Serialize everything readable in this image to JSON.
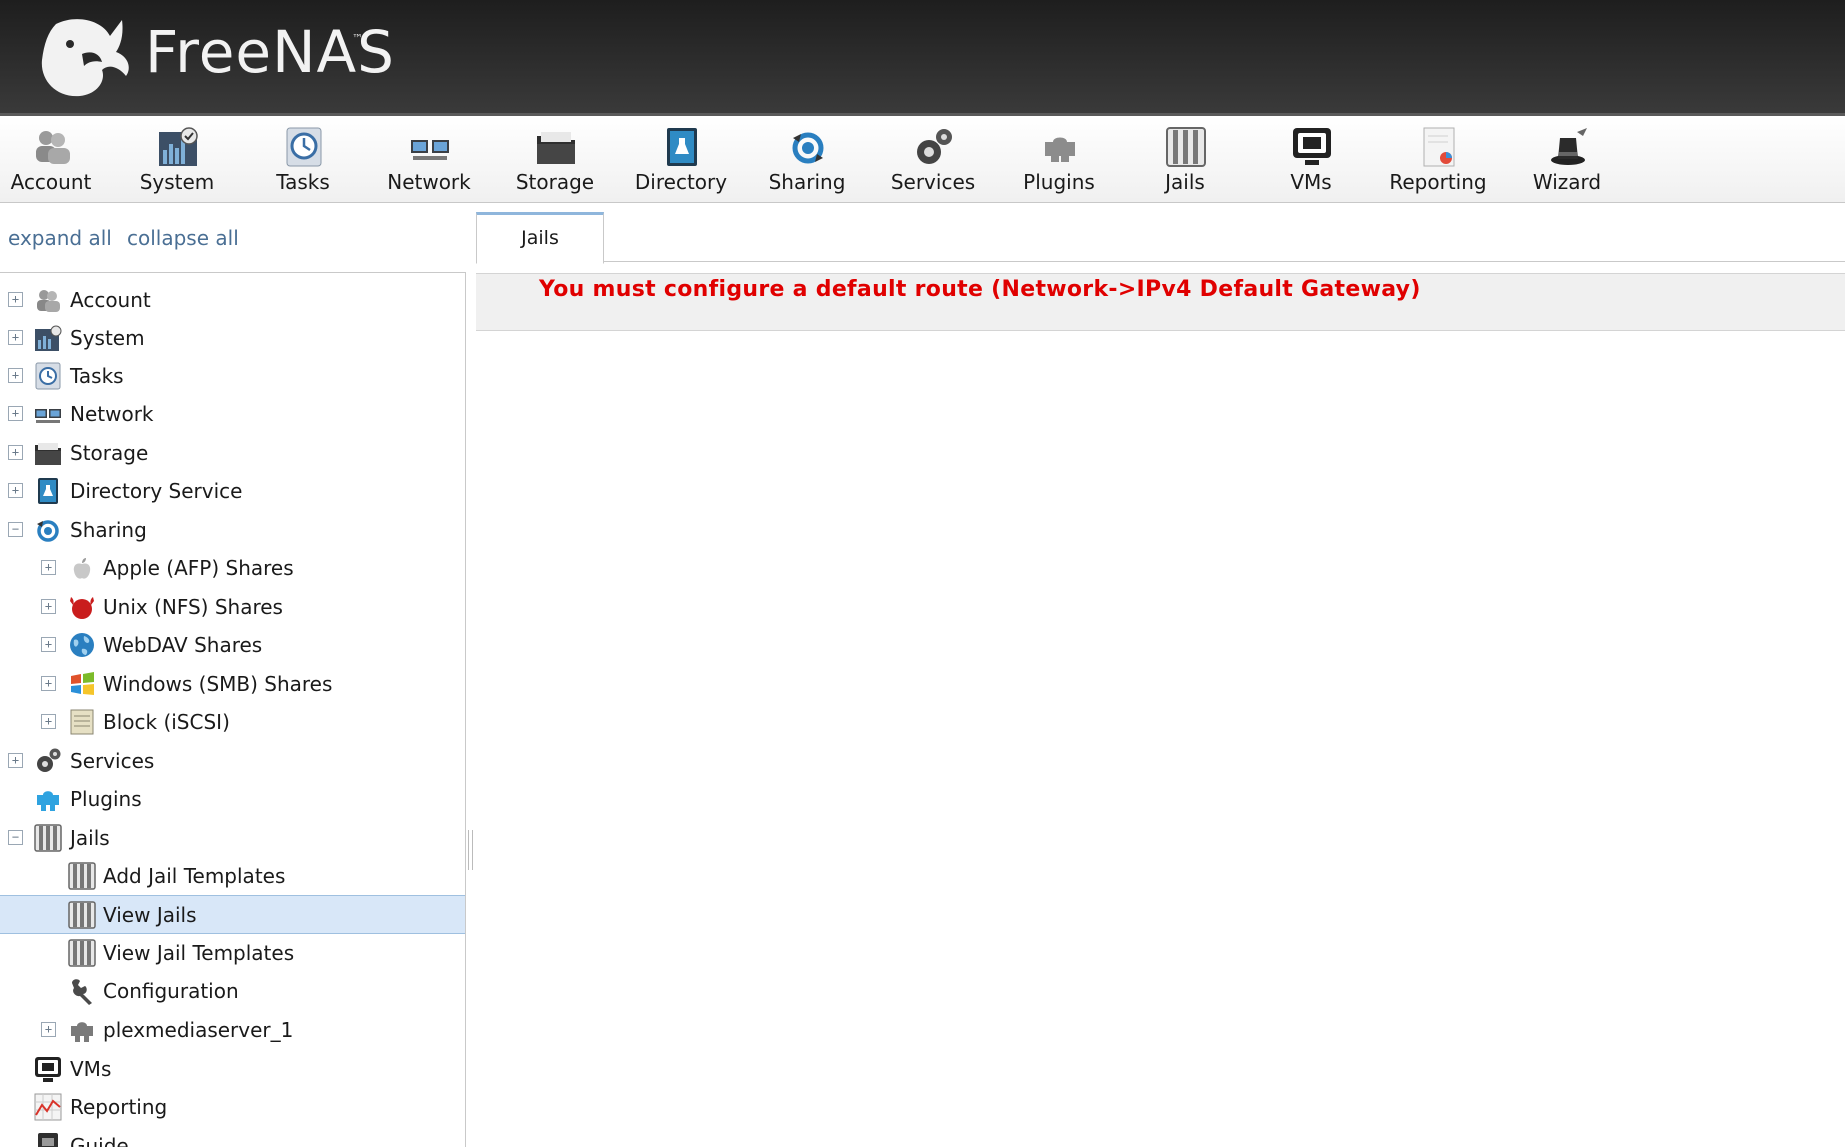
{
  "header": {
    "brand": "FreeNAS",
    "trademark": "™"
  },
  "toolbar": {
    "items": [
      {
        "label": "Account",
        "icon": "account-icon"
      },
      {
        "label": "System",
        "icon": "system-icon"
      },
      {
        "label": "Tasks",
        "icon": "tasks-icon"
      },
      {
        "label": "Network",
        "icon": "network-icon"
      },
      {
        "label": "Storage",
        "icon": "storage-icon"
      },
      {
        "label": "Directory",
        "icon": "directory-icon"
      },
      {
        "label": "Sharing",
        "icon": "sharing-icon"
      },
      {
        "label": "Services",
        "icon": "services-icon"
      },
      {
        "label": "Plugins",
        "icon": "plugins-icon"
      },
      {
        "label": "Jails",
        "icon": "jails-icon"
      },
      {
        "label": "VMs",
        "icon": "vms-icon"
      },
      {
        "label": "Reporting",
        "icon": "reporting-icon"
      },
      {
        "label": "Wizard",
        "icon": "wizard-icon"
      }
    ]
  },
  "sidebar": {
    "expand_all": "expand all",
    "collapse_all": "collapse all",
    "tree": [
      {
        "label": "Account",
        "toggle": "+",
        "icon": "account-icon"
      },
      {
        "label": "System",
        "toggle": "+",
        "icon": "system-icon"
      },
      {
        "label": "Tasks",
        "toggle": "+",
        "icon": "tasks-icon"
      },
      {
        "label": "Network",
        "toggle": "+",
        "icon": "network-icon"
      },
      {
        "label": "Storage",
        "toggle": "+",
        "icon": "storage-icon"
      },
      {
        "label": "Directory Service",
        "toggle": "+",
        "icon": "directory-icon"
      },
      {
        "label": "Sharing",
        "toggle": "−",
        "icon": "sharing-icon"
      },
      {
        "label": "Apple (AFP) Shares",
        "toggle": "+",
        "icon": "apple-icon"
      },
      {
        "label": "Unix (NFS) Shares",
        "toggle": "+",
        "icon": "freebsd-icon"
      },
      {
        "label": "WebDAV Shares",
        "toggle": "+",
        "icon": "globe-icon"
      },
      {
        "label": "Windows (SMB) Shares",
        "toggle": "+",
        "icon": "windows-icon"
      },
      {
        "label": "Block (iSCSI)",
        "toggle": "+",
        "icon": "block-icon"
      },
      {
        "label": "Services",
        "toggle": "+",
        "icon": "services-icon"
      },
      {
        "label": "Plugins",
        "toggle": "",
        "icon": "plugins-icon"
      },
      {
        "label": "Jails",
        "toggle": "−",
        "icon": "jails-icon"
      },
      {
        "label": "Add Jail Templates",
        "toggle": "",
        "icon": "jails-icon"
      },
      {
        "label": "View Jails",
        "toggle": "",
        "icon": "jails-icon",
        "selected": true
      },
      {
        "label": "View Jail Templates",
        "toggle": "",
        "icon": "jails-icon"
      },
      {
        "label": "Configuration",
        "toggle": "",
        "icon": "wrench-icon"
      },
      {
        "label": "plexmediaserver_1",
        "toggle": "+",
        "icon": "plugin-gray-icon"
      },
      {
        "label": "VMs",
        "toggle": "",
        "icon": "vms-icon"
      },
      {
        "label": "Reporting",
        "toggle": "",
        "icon": "reporting-icon"
      },
      {
        "label": "Guide",
        "toggle": "",
        "icon": "guide-icon"
      }
    ]
  },
  "main": {
    "tab_label": "Jails",
    "alert": "You must configure a default route (Network->IPv4 Default Gateway)"
  },
  "colors": {
    "alert": "#e00000",
    "link": "#4a6f94",
    "selected_row": "#d8e7f8",
    "header_bg": "#2d2d2d"
  }
}
